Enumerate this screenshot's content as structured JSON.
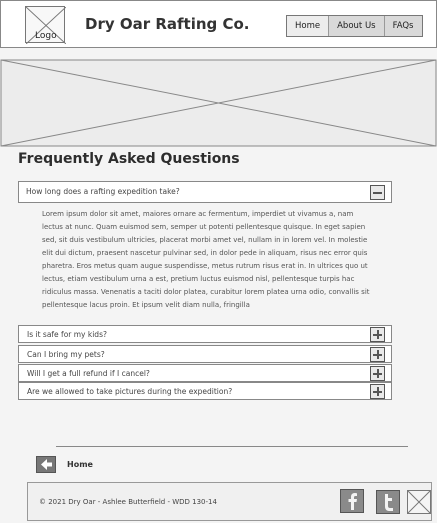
{
  "header": {
    "logo_label": "Logo",
    "brand": "Dry Oar Rafting Co.",
    "nav": [
      {
        "label": "Home"
      },
      {
        "label": "About Us"
      },
      {
        "label": "FAQs"
      }
    ]
  },
  "faq": {
    "title": "Frequently Asked Questions",
    "open_item": {
      "question": "How long does a rafting expedition take?",
      "answer": "Lorem ipsum dolor sit amet, maiores ornare ac fermentum, imperdiet ut vivamus a, nam lectus at nunc. Quam euismod sem, semper ut potenti pellentesque quisque. In eget sapien sed, sit duis vestibulum ultricies, placerat morbi amet vel, nullam in in lorem vel. In molestie elit dui dictum, praesent nascetur pulvinar sed, in dolor pede in aliquam, risus nec error quis pharetra. Eros metus quam augue suspendisse, metus rutrum risus erat in. In ultrices quo ut lectus, etiam vestibulum urna a est, pretium luctus euismod nisl, pellentesque turpis hac ridiculus massa. Venenatis a taciti dolor platea, curabitur lorem platea urna odio, convallis sit pellentesque lacus proin. Et ipsum velit diam nulla, fringilla"
    },
    "items": [
      {
        "question": "Is it safe for my kids?"
      },
      {
        "question": "Can I bring my pets?"
      },
      {
        "question": "Will I get a full refund if I cancel?"
      },
      {
        "question": "Are we allowed to take pictures during the expedition?"
      }
    ]
  },
  "back": {
    "label": "Home"
  },
  "footer": {
    "copyright": "© 2021 Dry Oar - Ashlee Butterfield - WDD 130-14",
    "social": [
      {
        "icon": "facebook-icon"
      },
      {
        "icon": "twitter-icon"
      },
      {
        "icon": "image-placeholder-icon"
      }
    ]
  },
  "colors": {
    "background": "#f4f4f4",
    "border": "#888888",
    "nav_bg": "#d9d9d9",
    "icon_gray": "#777777"
  }
}
